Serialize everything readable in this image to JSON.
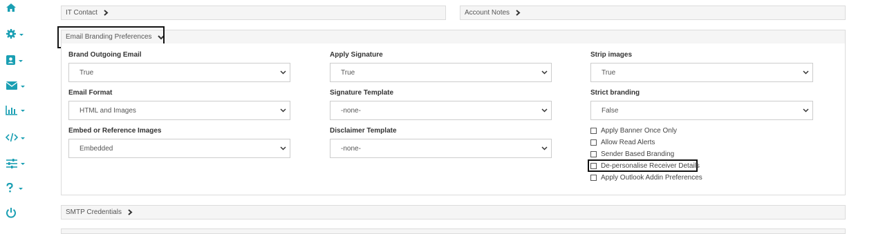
{
  "sidebar": {
    "items": [
      {
        "icon": "home-icon"
      },
      {
        "icon": "gear-icon"
      },
      {
        "icon": "contact-card-icon"
      },
      {
        "icon": "envelope-icon"
      },
      {
        "icon": "bar-chart-icon"
      },
      {
        "icon": "code-icon"
      },
      {
        "icon": "sliders-icon"
      },
      {
        "icon": "question-icon"
      },
      {
        "icon": "power-icon"
      }
    ],
    "icon_color": "#1a9fb3"
  },
  "panels": {
    "it_contact": "IT Contact",
    "account_notes": "Account Notes",
    "email_branding": "Email Branding Preferences",
    "smtp_credentials": "SMTP Credentials"
  },
  "fields": {
    "brand_outgoing": {
      "label": "Brand Outgoing Email",
      "value": "True"
    },
    "apply_signature": {
      "label": "Apply Signature",
      "value": "True"
    },
    "strip_images": {
      "label": "Strip images",
      "value": "True"
    },
    "email_format": {
      "label": "Email Format",
      "value": "HTML and Images"
    },
    "signature_template": {
      "label": "Signature Template",
      "value": "-none-"
    },
    "strict_branding": {
      "label": "Strict branding",
      "value": "False"
    },
    "embed_reference": {
      "label": "Embed or Reference Images",
      "value": "Embedded"
    },
    "disclaimer_template": {
      "label": "Disclaimer Template",
      "value": "-none-"
    }
  },
  "checkboxes": [
    {
      "label": "Apply Banner Once Only",
      "checked": false
    },
    {
      "label": "Allow Read Alerts",
      "checked": false
    },
    {
      "label": "Sender Based Branding",
      "checked": false
    },
    {
      "label": "De-personalise Receiver Details",
      "checked": false
    },
    {
      "label": "Apply Outlook Addin Preferences",
      "checked": false
    }
  ]
}
